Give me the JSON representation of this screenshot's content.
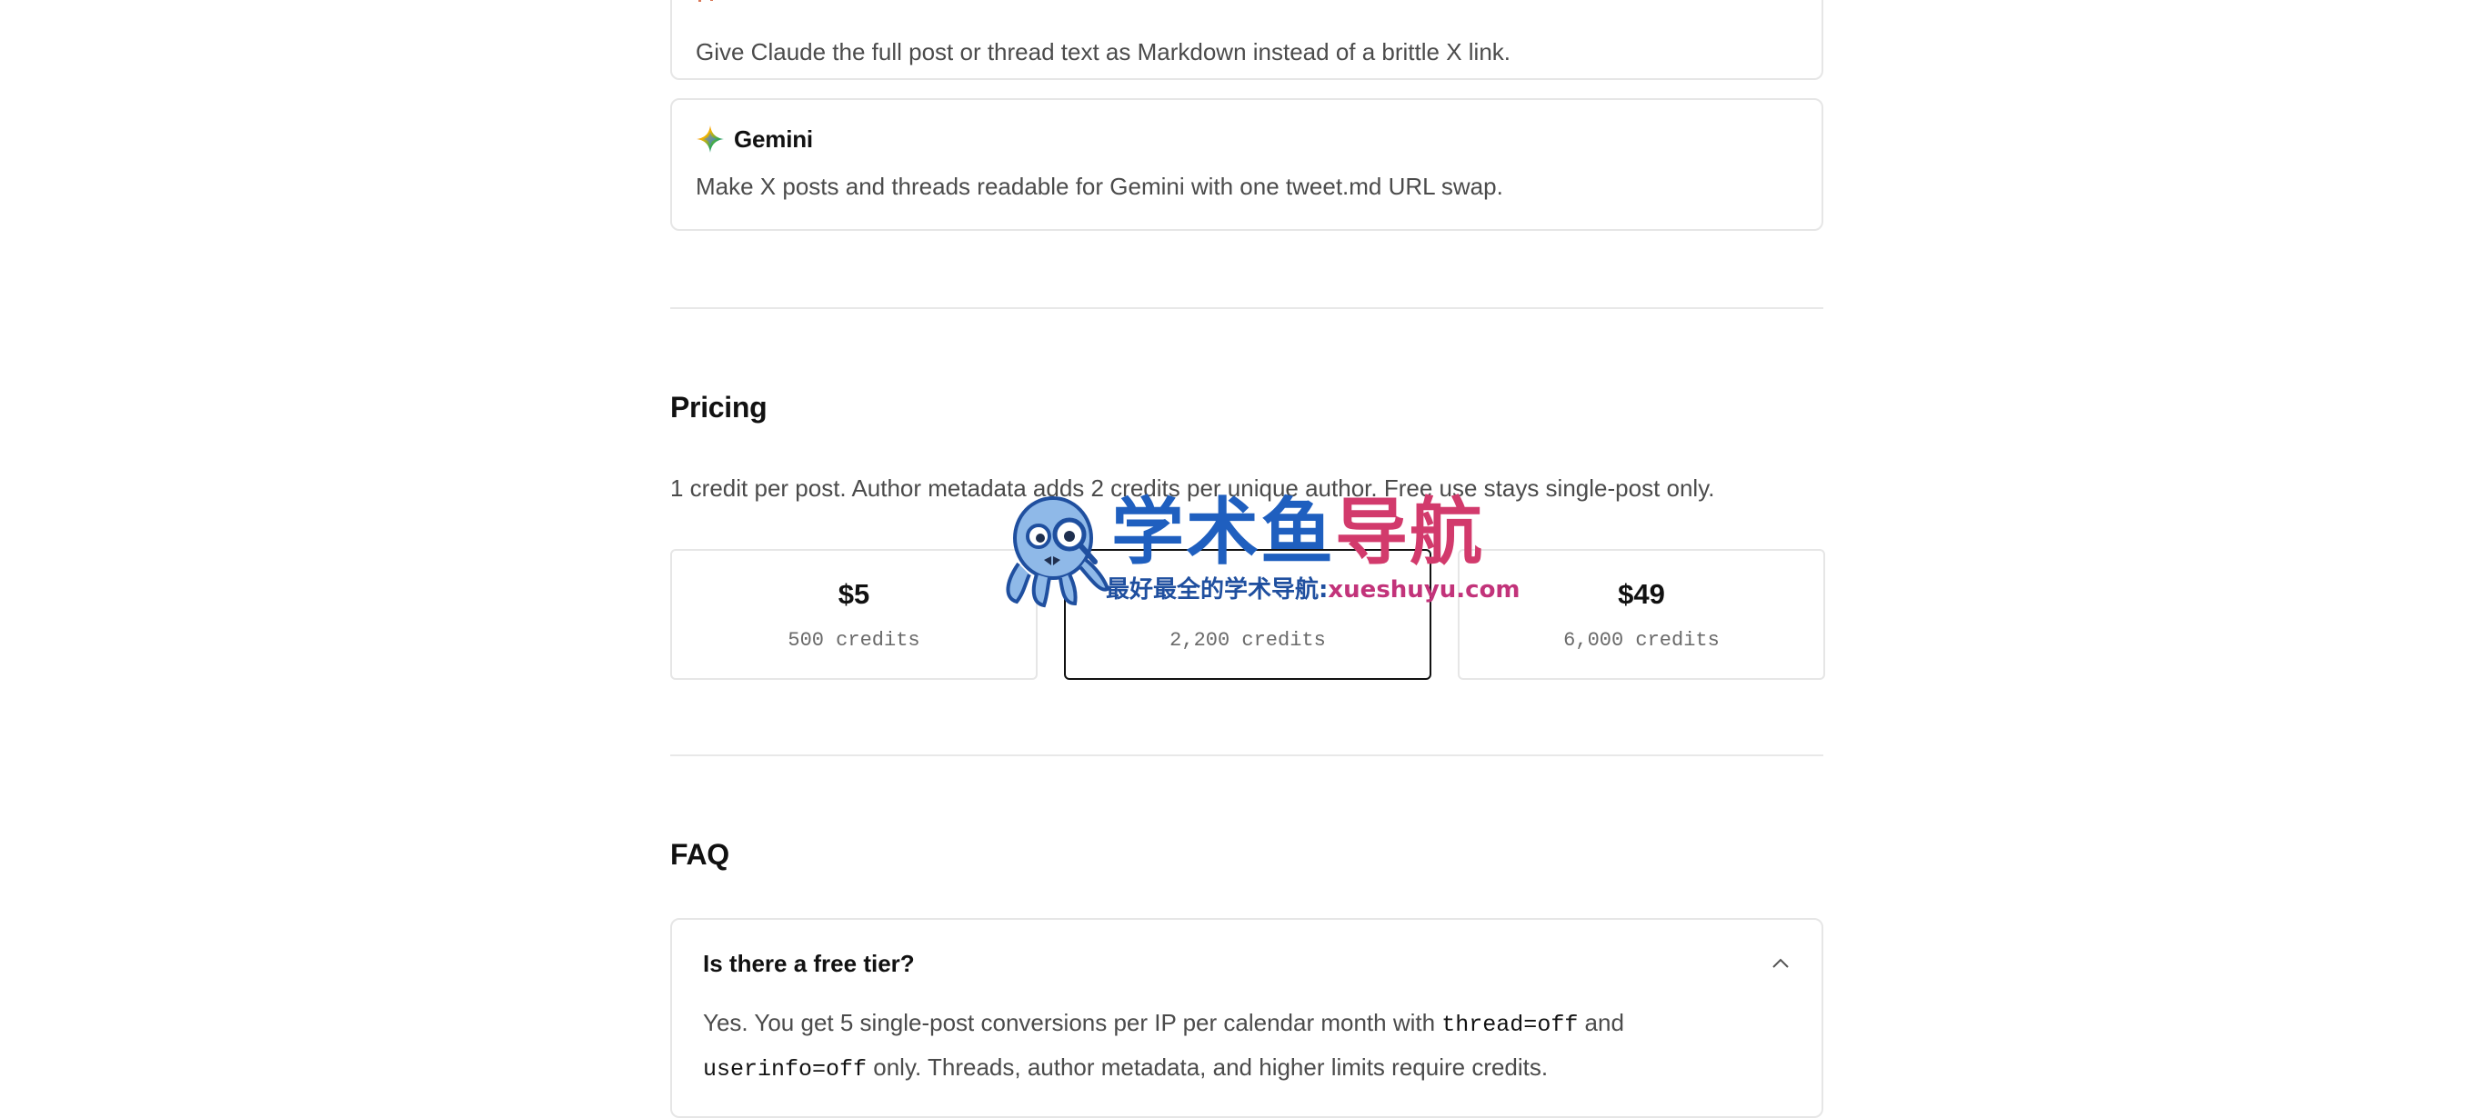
{
  "integrations": [
    {
      "name": "",
      "icon": "claude-icon",
      "description": "Give Claude the full post or thread text as Markdown instead of a brittle X link."
    },
    {
      "name": "Gemini",
      "icon": "gemini-sparkle-icon",
      "description": "Make X posts and threads readable for Gemini with one tweet.md URL swap."
    }
  ],
  "pricing": {
    "title": "Pricing",
    "description": "1 credit per post. Author metadata adds 2 credits per unique author. Free use stays single-post only.",
    "tiers": [
      {
        "price": "$5",
        "credits": "500 credits",
        "selected": false
      },
      {
        "price": "",
        "credits": "2,200 credits",
        "selected": true
      },
      {
        "price": "$49",
        "credits": "6,000 credits",
        "selected": false
      }
    ]
  },
  "faq": {
    "title": "FAQ",
    "items": [
      {
        "question": "Is there a free tier?",
        "expanded": true,
        "answer_parts": {
          "p1": "Yes. You get 5 single-post conversions per IP per calendar month with ",
          "code1": "thread=off",
          "p2": " and ",
          "code2": "userinfo=off",
          "p3": " only. Threads, author metadata, and higher limits require credits."
        }
      }
    ]
  },
  "watermark": {
    "title_part1": "学术鱼",
    "title_part2": "导航",
    "subtitle_part1": "最好最全的学术导航:",
    "subtitle_part2": "xueshuyu.com"
  },
  "colors": {
    "gemini_blue": "#4a7cf0",
    "gemini_red": "#e8453c",
    "gemini_yellow": "#f4b400",
    "gemini_green": "#34a853",
    "claude_orange": "#d97757",
    "selected_border": "#111111"
  }
}
